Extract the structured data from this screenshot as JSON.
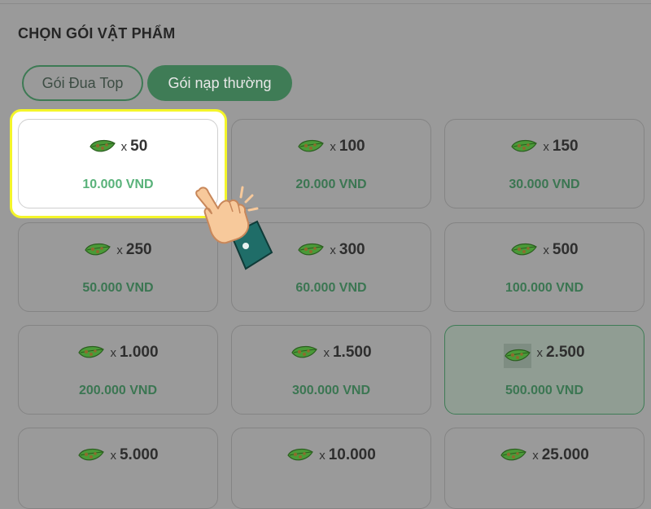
{
  "title": "CHỌN GÓI VẬT PHẨM",
  "tabs": [
    {
      "label": "Gói Đua Top"
    },
    {
      "label": "Gói nạp thường"
    }
  ],
  "multiplier_symbol": "x",
  "packages": [
    {
      "quantity": "50",
      "price": "10.000 VND"
    },
    {
      "quantity": "100",
      "price": "20.000 VND"
    },
    {
      "quantity": "150",
      "price": "30.000 VND"
    },
    {
      "quantity": "250",
      "price": "50.000 VND"
    },
    {
      "quantity": "300",
      "price": "60.000 VND"
    },
    {
      "quantity": "500",
      "price": "100.000 VND"
    },
    {
      "quantity": "1.000",
      "price": "200.000 VND"
    },
    {
      "quantity": "1.500",
      "price": "300.000 VND"
    },
    {
      "quantity": "2.500",
      "price": "500.000 VND"
    },
    {
      "quantity": "5.000",
      "price": ""
    },
    {
      "quantity": "10.000",
      "price": ""
    },
    {
      "quantity": "25.000",
      "price": ""
    }
  ],
  "icons": {
    "item": "leaf-icon",
    "pointer": "pointing-hand-icon"
  },
  "colors": {
    "accent": "#3f7c56",
    "price": "#3b7652",
    "highlight_border": "#f4f52a"
  }
}
